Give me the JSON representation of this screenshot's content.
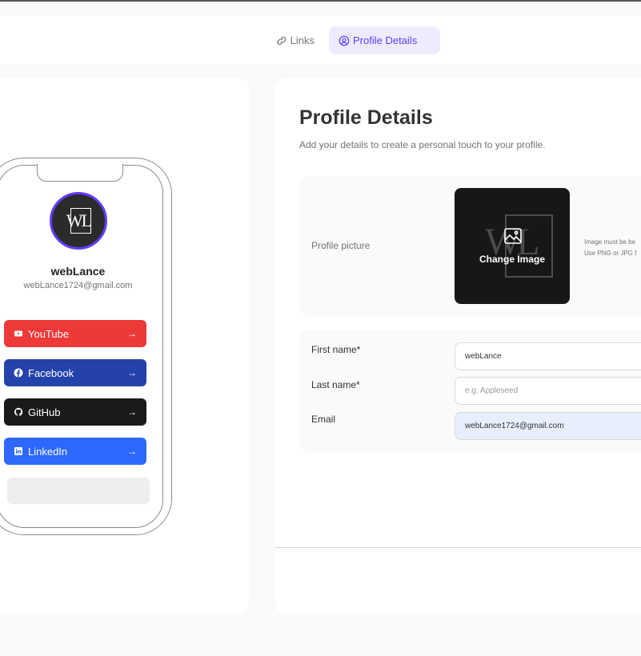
{
  "header": {
    "tabs": [
      {
        "label": "Links",
        "icon": "link-icon"
      },
      {
        "label": "Profile Details",
        "icon": "user-circle-icon",
        "active": true
      }
    ]
  },
  "preview": {
    "avatar_text": "WL",
    "name": "webLance",
    "email": "webLance1724@gmail.com",
    "links": [
      {
        "platform": "YouTube",
        "icon": "youtube-icon",
        "color": "#EE3939"
      },
      {
        "platform": "Facebook",
        "icon": "facebook-icon",
        "color": "#2442AC"
      },
      {
        "platform": "GitHub",
        "icon": "github-icon",
        "color": "#1A1A1A"
      },
      {
        "platform": "LinkedIn",
        "icon": "linkedin-icon",
        "color": "#2D68FF"
      }
    ],
    "arrow": "→"
  },
  "profile": {
    "title": "Profile Details",
    "subtitle": "Add your details to create a personal touch to your profile.",
    "picture_label": "Profile picture",
    "change_image": "Change Image",
    "image_note_line1": "Image must be be",
    "image_note_line2": "Use PNG or JPG f",
    "image_placeholder_text": "WL"
  },
  "form": {
    "first_name_label": "First name*",
    "first_name_value": "webLance",
    "last_name_label": "Last name*",
    "last_name_value": "",
    "last_name_placeholder": "e.g. Appleseed",
    "email_label": "Email",
    "email_value": "webLance1724@gmail.com"
  },
  "colors": {
    "accent": "#633CFF",
    "accent_light": "#EFEBFF"
  }
}
